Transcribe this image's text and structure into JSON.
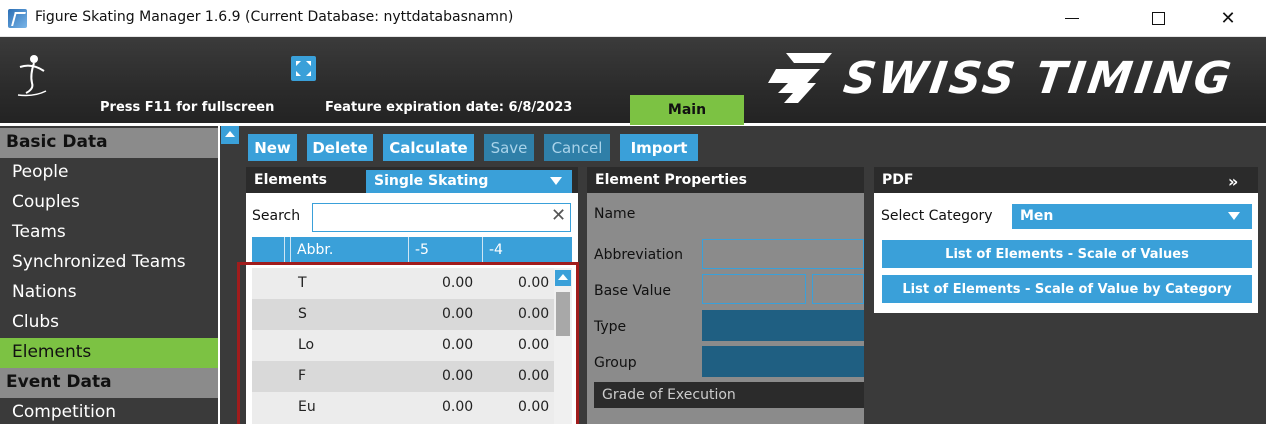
{
  "window": {
    "title": "Figure Skating Manager 1.6.9 (Current Database: nyttdatabasnamn)",
    "minimize": "—",
    "maximize": "☐",
    "close": "✕"
  },
  "header": {
    "fullscreen_hint": "Press F11 for fullscreen",
    "expiration": "Feature expiration date: 6/8/2023",
    "main_button": "Main",
    "logo_text": "SWISS TIMING"
  },
  "sidebar": {
    "sections": [
      {
        "label": "Basic Data"
      },
      {
        "label": "Event Data"
      }
    ],
    "items": [
      {
        "label": "People"
      },
      {
        "label": "Couples"
      },
      {
        "label": "Teams"
      },
      {
        "label": "Synchronized Teams"
      },
      {
        "label": "Nations"
      },
      {
        "label": "Clubs"
      },
      {
        "label": "Elements",
        "active": true
      },
      {
        "label": "Competition"
      }
    ]
  },
  "toolbar": {
    "new": "New",
    "delete": "Delete",
    "calculate": "Calculate",
    "save": "Save",
    "cancel": "Cancel",
    "import": "Import"
  },
  "elements_panel": {
    "title": "Elements",
    "discipline": "Single Skating",
    "search_label": "Search",
    "search_value": "",
    "search_clear": "✕",
    "columns": [
      "",
      "Abbr.",
      "-5",
      "-4"
    ],
    "rows": [
      {
        "abbr": "T",
        "c1": "0.00",
        "c2": "0.00"
      },
      {
        "abbr": "S",
        "c1": "0.00",
        "c2": "0.00"
      },
      {
        "abbr": "Lo",
        "c1": "0.00",
        "c2": "0.00"
      },
      {
        "abbr": "F",
        "c1": "0.00",
        "c2": "0.00"
      },
      {
        "abbr": "Eu",
        "c1": "0.00",
        "c2": "0.00"
      }
    ]
  },
  "properties_panel": {
    "title": "Element Properties",
    "name_label": "Name",
    "abbreviation_label": "Abbreviation",
    "base_value_label": "Base Value",
    "type_label": "Type",
    "group_label": "Group",
    "goe_title": "Grade of Execution"
  },
  "pdf_panel": {
    "title": "PDF",
    "expand": "»",
    "select_category_label": "Select Category",
    "category": "Men",
    "buttons": [
      {
        "label": "List of Elements - Scale of Values"
      },
      {
        "label": "List of Elements - Scale of Value by Category"
      }
    ]
  },
  "colors": {
    "accent": "#3aa0d9",
    "active": "#7cc243",
    "dark": "#3a3a3a",
    "highlight": "#a01c1c"
  }
}
